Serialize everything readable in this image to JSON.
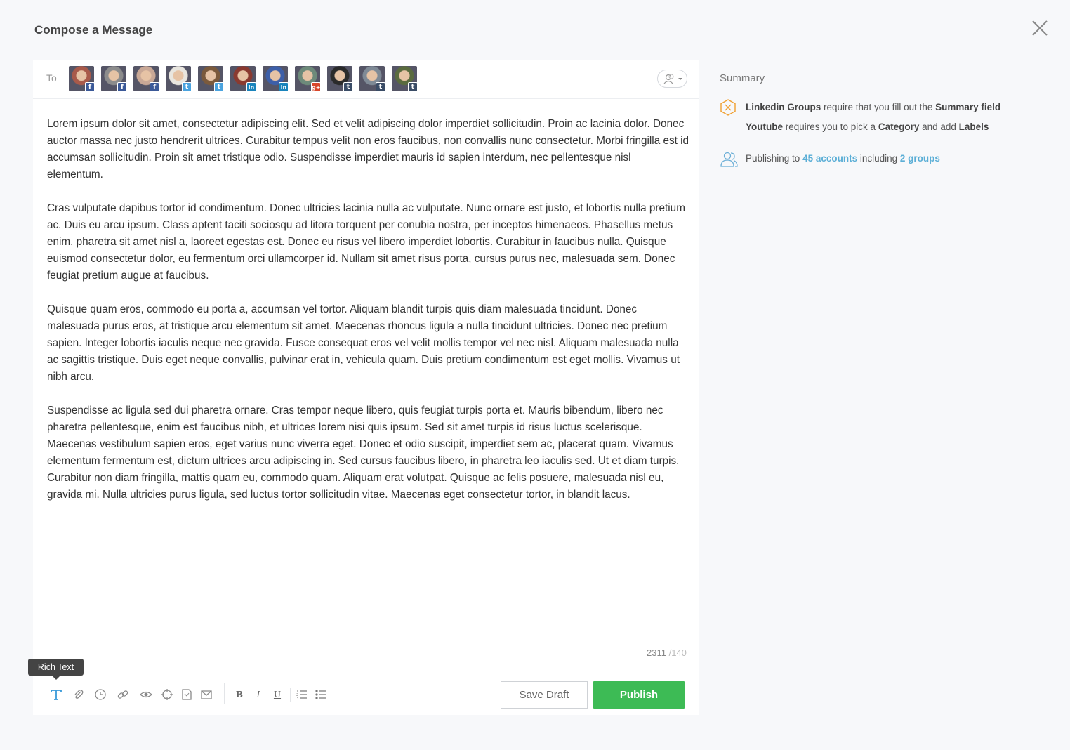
{
  "header": {
    "title": "Compose a Message"
  },
  "recipients": {
    "to_label": "To",
    "avatars": [
      {
        "network": "facebook",
        "badge": "f",
        "color": "#a85a4a"
      },
      {
        "network": "facebook",
        "badge": "f",
        "color": "#8c8c8c"
      },
      {
        "network": "facebook",
        "badge": "f",
        "color": "#c9a896"
      },
      {
        "network": "twitter",
        "badge": "t",
        "color": "#e9e6df"
      },
      {
        "network": "twitter",
        "badge": "t",
        "color": "#7b5a3c"
      },
      {
        "network": "linkedin",
        "badge": "in",
        "color": "#8a3a30"
      },
      {
        "network": "linkedin",
        "badge": "in",
        "color": "#3d5fa8"
      },
      {
        "network": "googleplus",
        "badge": "g+",
        "color": "#6d8a7a"
      },
      {
        "network": "tumblr",
        "badge": "t",
        "color": "#2b2b2b"
      },
      {
        "network": "tumblr",
        "badge": "t",
        "color": "#7f8a96"
      },
      {
        "network": "tumblr",
        "badge": "t",
        "color": "#5a6b3f"
      }
    ]
  },
  "editor": {
    "paragraphs": [
      "Lorem ipsum dolor sit amet, consectetur adipiscing elit. Sed et velit adipiscing dolor imperdiet sollicitudin. Proin ac lacinia dolor. Donec auctor massa nec justo hendrerit ultrices. Curabitur tempus velit non eros faucibus, non convallis nunc consectetur. Morbi fringilla est id accumsan sollicitudin. Proin sit amet tristique odio. Suspendisse imperdiet mauris id sapien interdum, nec pellentesque nisl elementum.",
      "Cras vulputate dapibus tortor id condimentum. Donec ultricies lacinia nulla ac vulputate. Nunc ornare est justo, et lobortis nulla pretium ac. Duis eu arcu ipsum. Class aptent taciti sociosqu ad litora torquent per conubia nostra, per inceptos himenaeos. Phasellus metus enim, pharetra sit amet nisl a, laoreet egestas est. Donec eu risus vel libero imperdiet lobortis. Curabitur in faucibus nulla. Quisque euismod consectetur dolor, eu fermentum orci ullamcorper id. Nullam sit amet risus porta, cursus purus nec, malesuada sem. Donec feugiat pretium augue at faucibus.",
      "Quisque quam eros, commodo eu porta a, accumsan vel tortor. Aliquam blandit turpis quis diam malesuada tincidunt. Donec malesuada purus eros, at tristique arcu elementum sit amet. Maecenas rhoncus ligula a nulla tincidunt ultricies. Donec nec pretium sapien. Integer lobortis iaculis neque nec gravida. Fusce consequat eros vel velit mollis tempor vel nec nisl. Aliquam malesuada nulla ac sagittis tristique. Duis eget neque convallis, pulvinar erat in, vehicula quam. Duis pretium condimentum est eget mollis. Vivamus ut nibh arcu.",
      "Suspendisse ac ligula sed dui pharetra ornare. Cras tempor neque libero, quis feugiat turpis porta et. Mauris bibendum, libero nec pharetra pellentesque, enim est faucibus nibh, et ultrices lorem nisi quis ipsum. Sed sit amet turpis id risus luctus scelerisque. Maecenas vestibulum sapien eros, eget varius nunc viverra eget. Donec et odio suscipit, imperdiet sem ac, placerat quam. Vivamus elementum fermentum est, dictum ultrices arcu adipiscing in. Sed cursus faucibus libero, in pharetra leo iaculis sed. Ut et diam turpis. Curabitur non diam fringilla, mattis quam eu, commodo quam. Aliquam erat volutpat. Quisque ac felis posuere, malesuada nisl eu, gravida mi. Nulla ultricies purus ligula, sed luctus tortor sollicitudin vitae. Maecenas eget consectetur tortor, in blandit lacus."
    ],
    "char_count": "2311",
    "char_limit": "/140"
  },
  "toolbar": {
    "tooltip": "Rich Text",
    "save_draft_label": "Save Draft",
    "publish_label": "Publish",
    "bold_glyph": "B",
    "italic_glyph": "I",
    "underline_glyph": "U",
    "accent_color": "#3a9ad9",
    "publish_color": "#3dbb55"
  },
  "summary": {
    "title": "Summary",
    "linkedin": {
      "name": "Linkedin Groups",
      "text1": " require that you fill out the ",
      "field": "Summary field"
    },
    "youtube": {
      "name": "Youtube",
      "text1": " requires you to pick a ",
      "category": "Category",
      "text2": " and add ",
      "labels": "Labels"
    },
    "publishing": {
      "prefix": "Publishing to ",
      "accounts": "45 accounts",
      "middle": " including ",
      "groups": "2 groups"
    },
    "warning_color": "#f0a030",
    "link_color": "#5aaed6"
  }
}
